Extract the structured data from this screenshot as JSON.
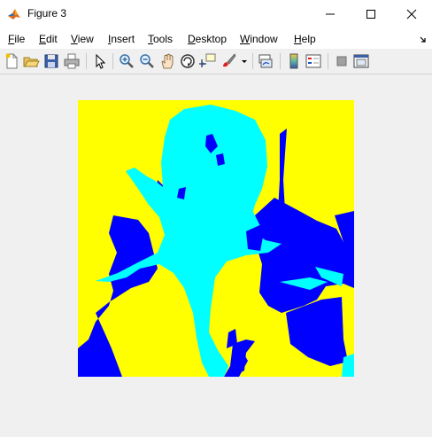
{
  "window": {
    "title": "Figure 3"
  },
  "menu": {
    "file": {
      "mnemonic": "F",
      "rest": "ile"
    },
    "edit": {
      "mnemonic": "E",
      "rest": "dit"
    },
    "view": {
      "mnemonic": "V",
      "rest": "iew"
    },
    "insert": {
      "mnemonic": "I",
      "rest": "nsert"
    },
    "tools": {
      "mnemonic": "T",
      "rest": "ools"
    },
    "desktop": {
      "mnemonic": "D",
      "rest": "esktop"
    },
    "window": {
      "mnemonic": "W",
      "rest": "indow"
    },
    "help": {
      "mnemonic": "H",
      "rest": "elp"
    }
  },
  "toolbar": {
    "icons": [
      "new-figure-icon",
      "open-file-icon",
      "save-icon",
      "print-icon",
      "pointer-icon",
      "zoom-in-icon",
      "zoom-out-icon",
      "pan-icon",
      "rotate-3d-icon",
      "data-cursor-icon",
      "brush-icon",
      "link-plot-icon",
      "colorbar-icon",
      "legend-icon",
      "hide-plot-tools-icon",
      "show-plot-tools-icon"
    ]
  },
  "figure": {
    "image_colors": {
      "background": "#ffff00",
      "flower": "#00ffff",
      "leaves": "#0000ff"
    }
  }
}
